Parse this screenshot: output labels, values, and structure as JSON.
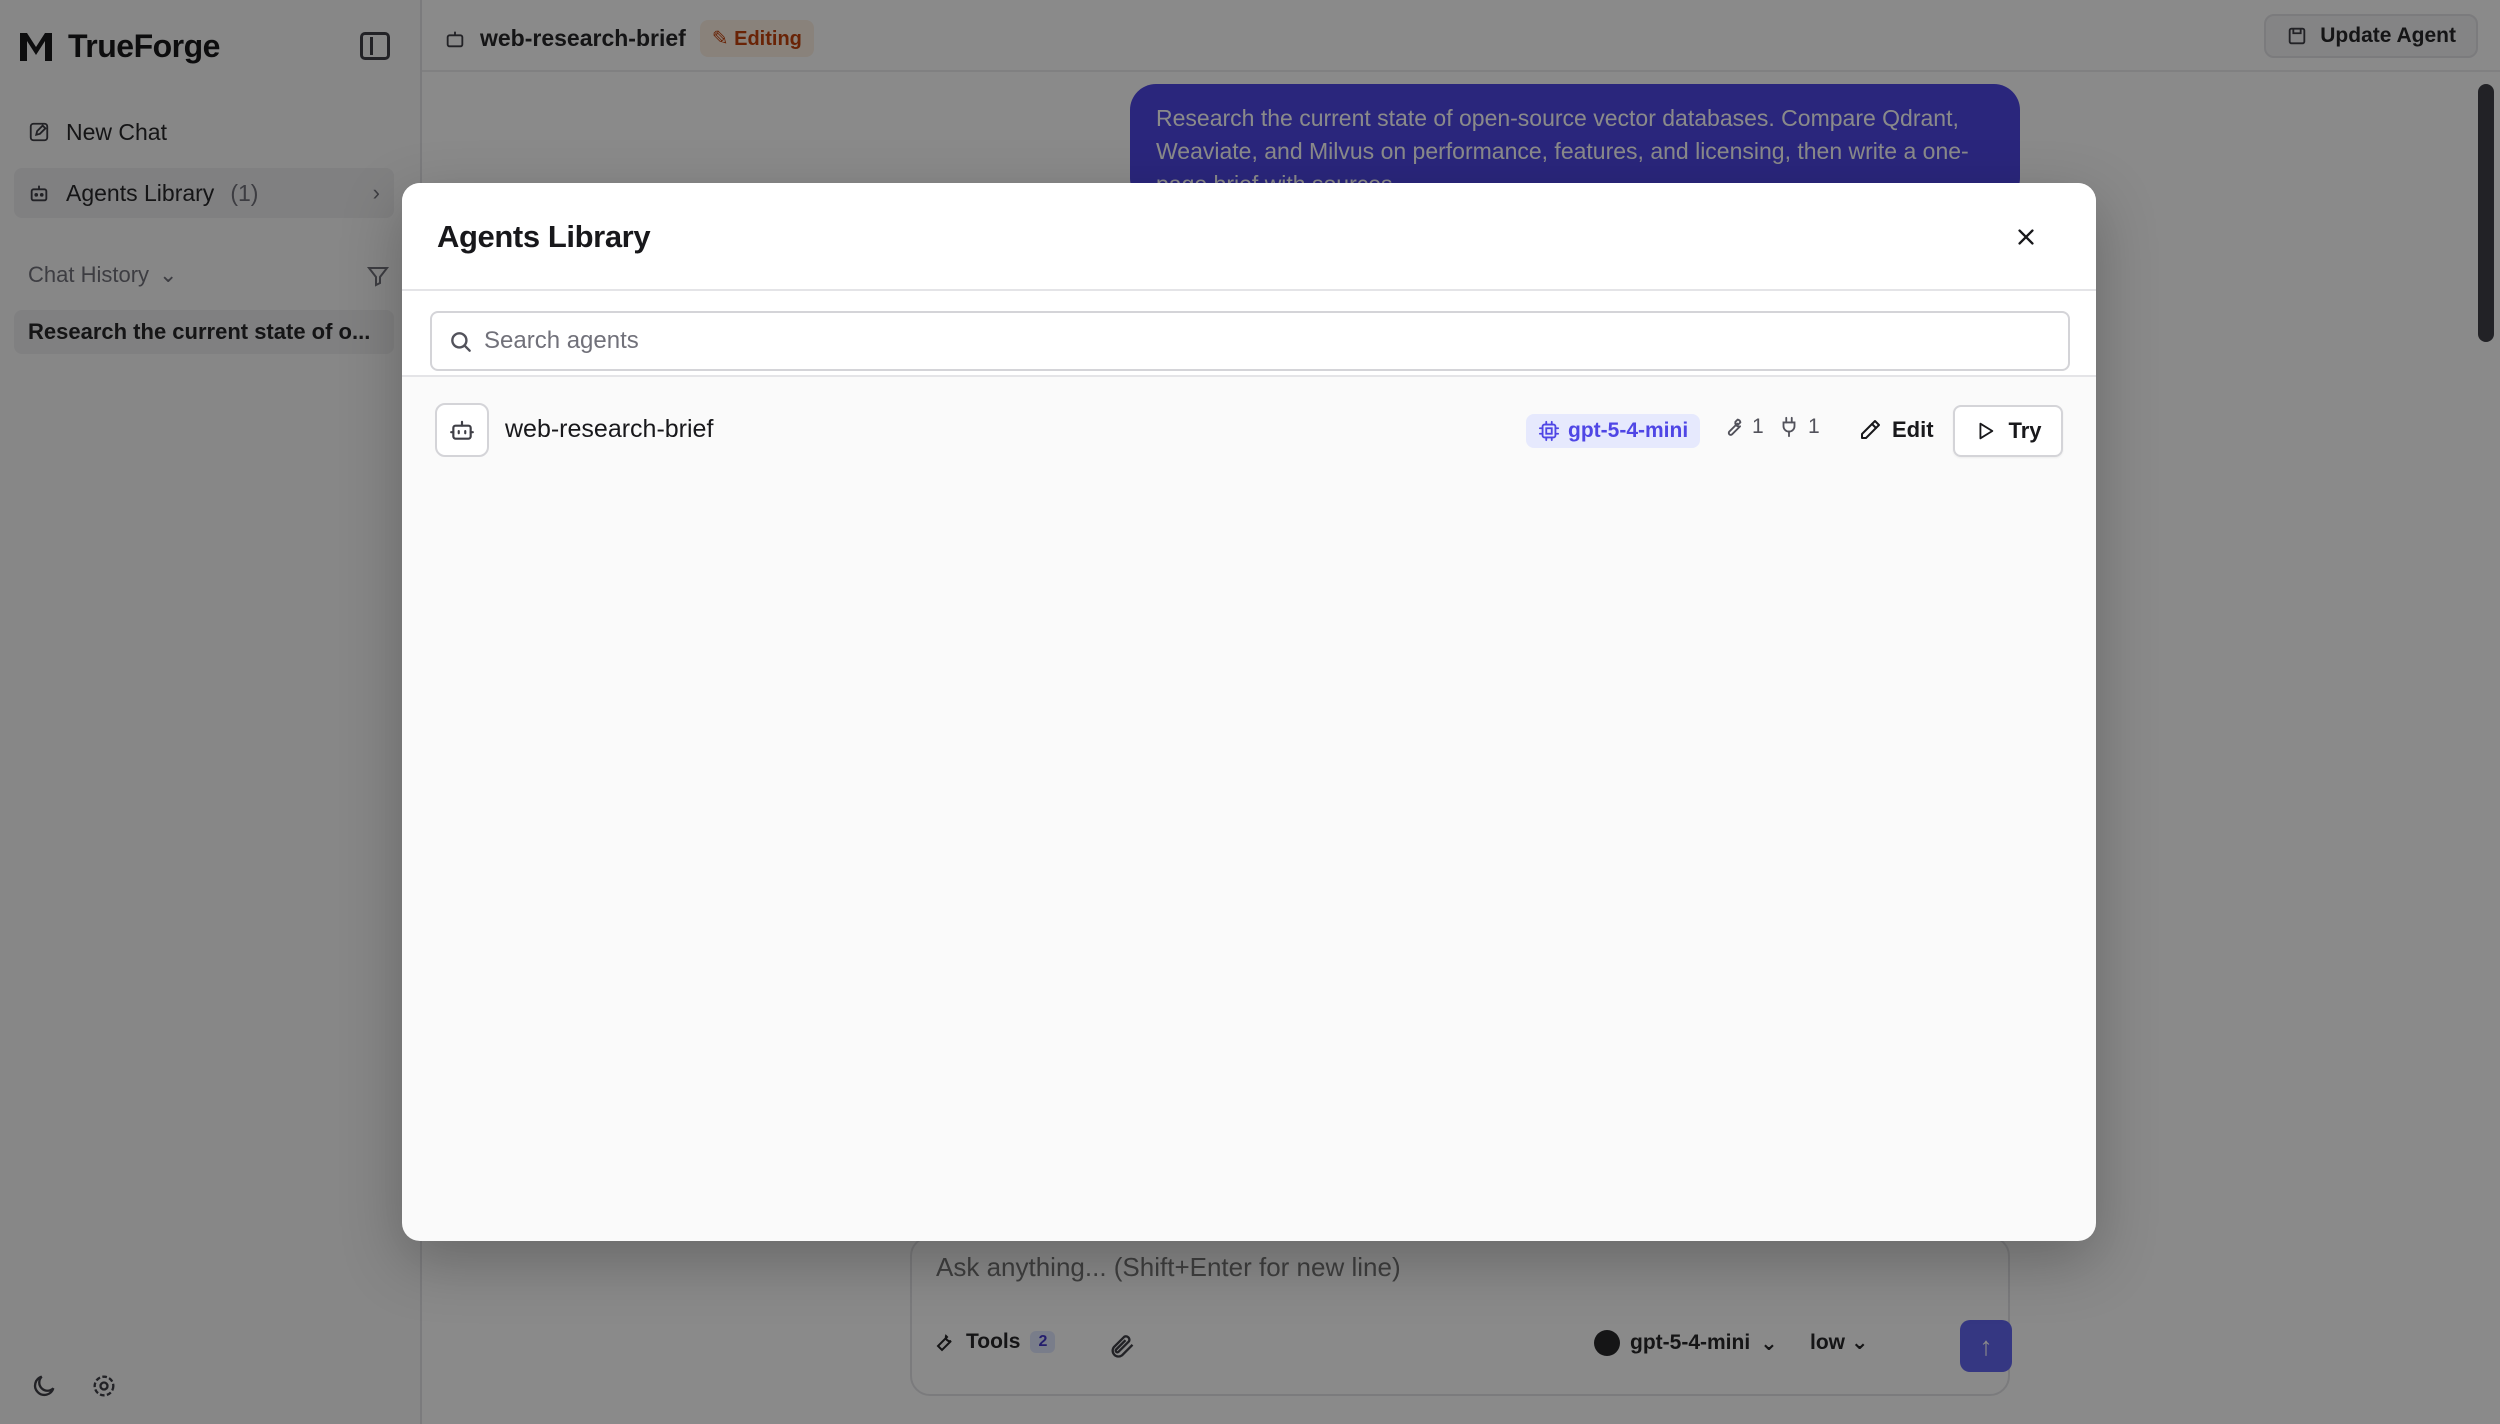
{
  "app": {
    "brand": "TrueForge",
    "sidebar": {
      "new_chat": "New Chat",
      "agents_library": "Agents Library",
      "agents_count": "(1)",
      "chat_history": "Chat History",
      "history_items": [
        "Research the current state of o..."
      ]
    },
    "header": {
      "agent_name": "web-research-brief",
      "editing_badge": "✎ Editing",
      "update_button": "Update Agent"
    },
    "chat": {
      "user_message": "Research the current state of open-source vector databases. Compare Qdrant, Weaviate, and Milvus on performance, features, and licensing, then write a one-page brief with sources."
    },
    "composer": {
      "placeholder": "Ask anything... (Shift+Enter for new line)",
      "tools_label": "Tools",
      "tools_count": "2",
      "model": "gpt-5-4-mini",
      "effort": "low"
    }
  },
  "modal": {
    "title": "Agents Library",
    "search_placeholder": "Search agents",
    "agents": [
      {
        "name": "web-research-brief",
        "model": "gpt-5-4-mini",
        "tools_count": "1",
        "plugins_count": "1",
        "edit_label": "Edit",
        "try_label": "Try"
      }
    ]
  },
  "colors": {
    "accent": "#4f46e5",
    "model_badge_bg": "#e6e9fd",
    "overlay": "rgba(0,0,0,0.46)"
  }
}
